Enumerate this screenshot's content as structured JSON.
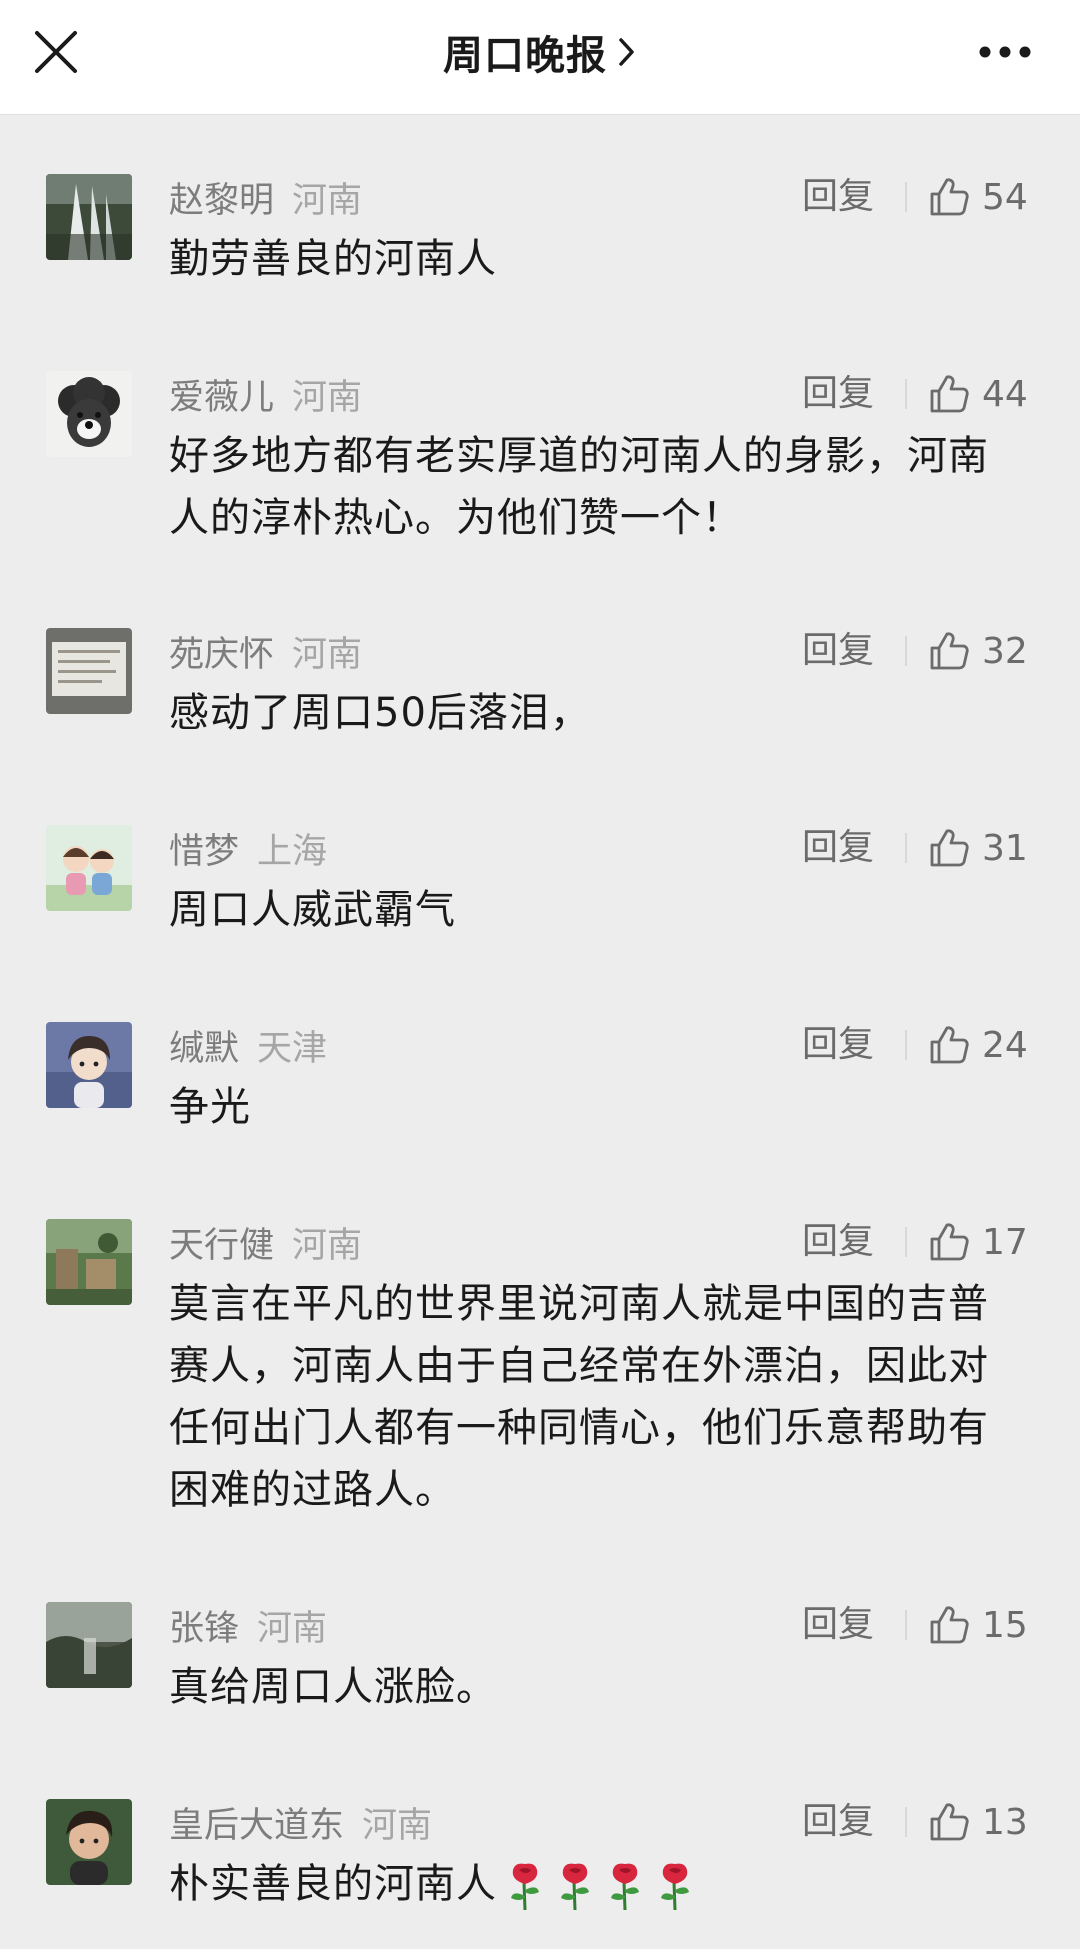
{
  "header": {
    "title": "周口晚报",
    "close_icon": "close-icon",
    "more_icon": "more-icon"
  },
  "reply_label": "回复",
  "comments": [
    {
      "name": "赵黎明",
      "region": "河南",
      "likes": "54",
      "text": "勤劳善良的河南人"
    },
    {
      "name": "爱薇儿",
      "region": "河南",
      "likes": "44",
      "text": "好多地方都有老实厚道的河南人的身影，河南人的淳朴热心。为他们赞一个！"
    },
    {
      "name": "苑庆怀",
      "region": "河南",
      "likes": "32",
      "text": "感动了周口50后落泪，"
    },
    {
      "name": "惜梦",
      "region": "上海",
      "likes": "31",
      "text": "周口人威武霸气"
    },
    {
      "name": "缄默",
      "region": "天津",
      "likes": "24",
      "text": "争光"
    },
    {
      "name": "天行健",
      "region": "河南",
      "likes": "17",
      "text": "莫言在平凡的世界里说河南人就是中国的吉普赛人，河南人由于自己经常在外漂泊，因此对任何出门人都有一种同情心，他们乐意帮助有困难的过路人。"
    },
    {
      "name": "张锋",
      "region": "河南",
      "likes": "15",
      "text": "真给周口人涨脸。"
    },
    {
      "name": "皇后大道东",
      "region": "河南",
      "likes": "13",
      "text": "朴实善良的河南人",
      "emoji": "rose-icon",
      "emoji_count": 4
    }
  ]
}
